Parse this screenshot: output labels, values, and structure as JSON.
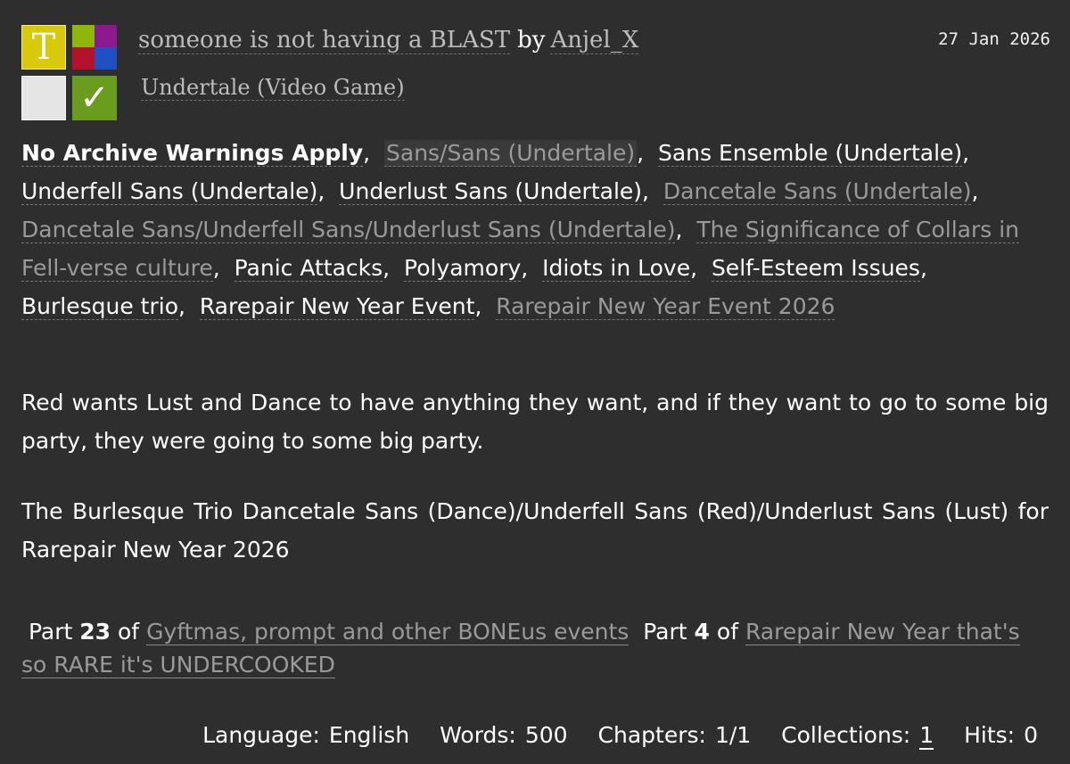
{
  "icons": {
    "rating": "T",
    "rating_color": "#d9c90b",
    "complete": "✓",
    "complete_color": "#6a9c1d"
  },
  "work": {
    "title": "someone is not having a BLAST",
    "by": "by",
    "author": "Anjel_X",
    "fandom": "Undertale (Video Game)",
    "date": "27 Jan 2026"
  },
  "tags": [
    {
      "text": "No Archive Warnings Apply",
      "style": "warn"
    },
    {
      "text": "Sans/Sans (Undertale)",
      "style": "grey hl"
    },
    {
      "text": "Sans Ensemble (Undertale)",
      "style": "white"
    },
    {
      "text": "Underfell Sans (Undertale)",
      "style": "white"
    },
    {
      "text": "Underlust Sans (Undertale)",
      "style": "white"
    },
    {
      "text": "Dancetale Sans (Undertale)",
      "style": "grey"
    },
    {
      "text": "Dancetale Sans/Underfell Sans/Underlust Sans (Undertale)",
      "style": "grey"
    },
    {
      "text": "The Significance of Collars in Fell-verse culture",
      "style": "grey"
    },
    {
      "text": "Panic Attacks",
      "style": "white"
    },
    {
      "text": "Polyamory",
      "style": "white"
    },
    {
      "text": "Idiots in Love",
      "style": "white"
    },
    {
      "text": "Self-Esteem Issues",
      "style": "white"
    },
    {
      "text": "Burlesque trio",
      "style": "white"
    },
    {
      "text": "Rarepair New Year Event",
      "style": "white"
    },
    {
      "text": "Rarepair New Year Event 2026",
      "style": "grey"
    }
  ],
  "summary": {
    "p1": "Red wants Lust and Dance to have anything they want, and if they want to go to some big party, they were going to some big party.",
    "p2": "The Burlesque Trio Dancetale Sans (Dance)/Underfell Sans (Red)/Underlust Sans (Lust) for Rarepair New Year 2026"
  },
  "series": [
    {
      "part_label": "Part",
      "part_num": "23",
      "of": "of",
      "name": "Gyftmas, prompt and other BONEus events"
    },
    {
      "part_label": "Part",
      "part_num": "4",
      "of": "of",
      "name": "Rarepair New Year that's so RARE it's UNDERCOOKED"
    }
  ],
  "stats": {
    "language_label": "Language:",
    "language": "English",
    "words_label": "Words:",
    "words": "500",
    "chapters_label": "Chapters:",
    "chapters": "1/1",
    "collections_label": "Collections:",
    "collections": "1",
    "hits_label": "Hits:",
    "hits": "0"
  }
}
